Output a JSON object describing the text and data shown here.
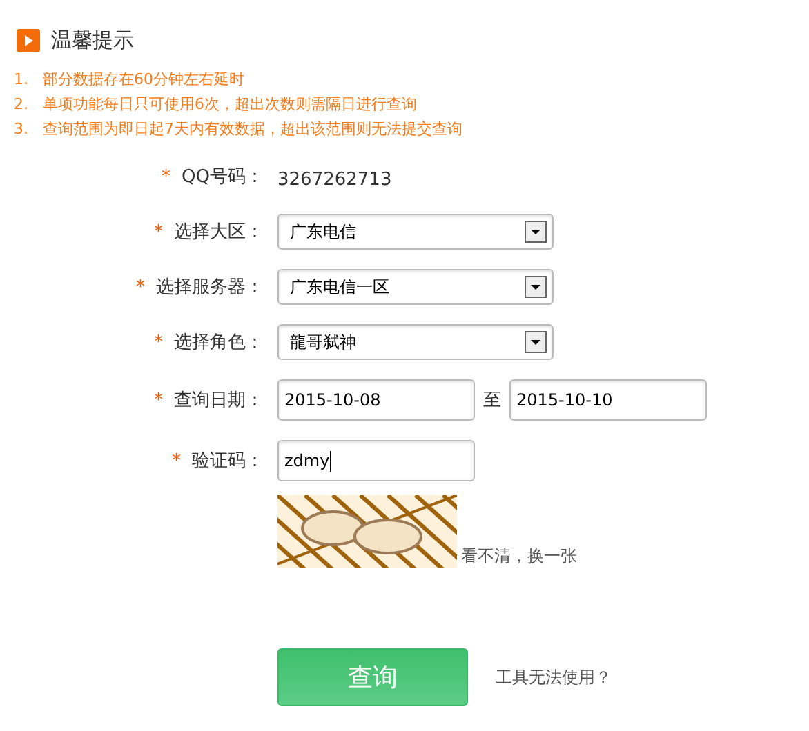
{
  "notice": {
    "title": "温馨提示",
    "items": [
      {
        "number": "1.",
        "text": "部分数据存在60分钟左右延时"
      },
      {
        "number": "2.",
        "text": "单项功能每日只可使用6次，超出次数则需隔日进行查询"
      },
      {
        "number": "3.",
        "text": "查询范围为即日起7天内有效数据，超出该范围则无法提交查询"
      }
    ]
  },
  "form": {
    "rows": [
      {
        "kind": "text",
        "required_mark": "*",
        "label": "QQ号码：",
        "value": "3267262713"
      },
      {
        "kind": "select",
        "required_mark": "*",
        "label": "选择大区：",
        "value": "广东电信"
      },
      {
        "kind": "select",
        "required_mark": "*",
        "label": "选择服务器：",
        "value": "广东电信一区"
      },
      {
        "kind": "select",
        "required_mark": "*",
        "label": "选择角色：",
        "value": "龍哥弑神"
      },
      {
        "kind": "daterange",
        "required_mark": "*",
        "label": "查询日期：",
        "from": "2015-10-08",
        "separator": "至",
        "to": "2015-10-10"
      },
      {
        "kind": "input",
        "required_mark": "*",
        "label": "验证码：",
        "value": "zdmy"
      }
    ],
    "captcha": {
      "kind": "picture",
      "refresh_link": "看不清，换一张"
    },
    "submit": "查询",
    "help_link": "工具无法使用？"
  }
}
